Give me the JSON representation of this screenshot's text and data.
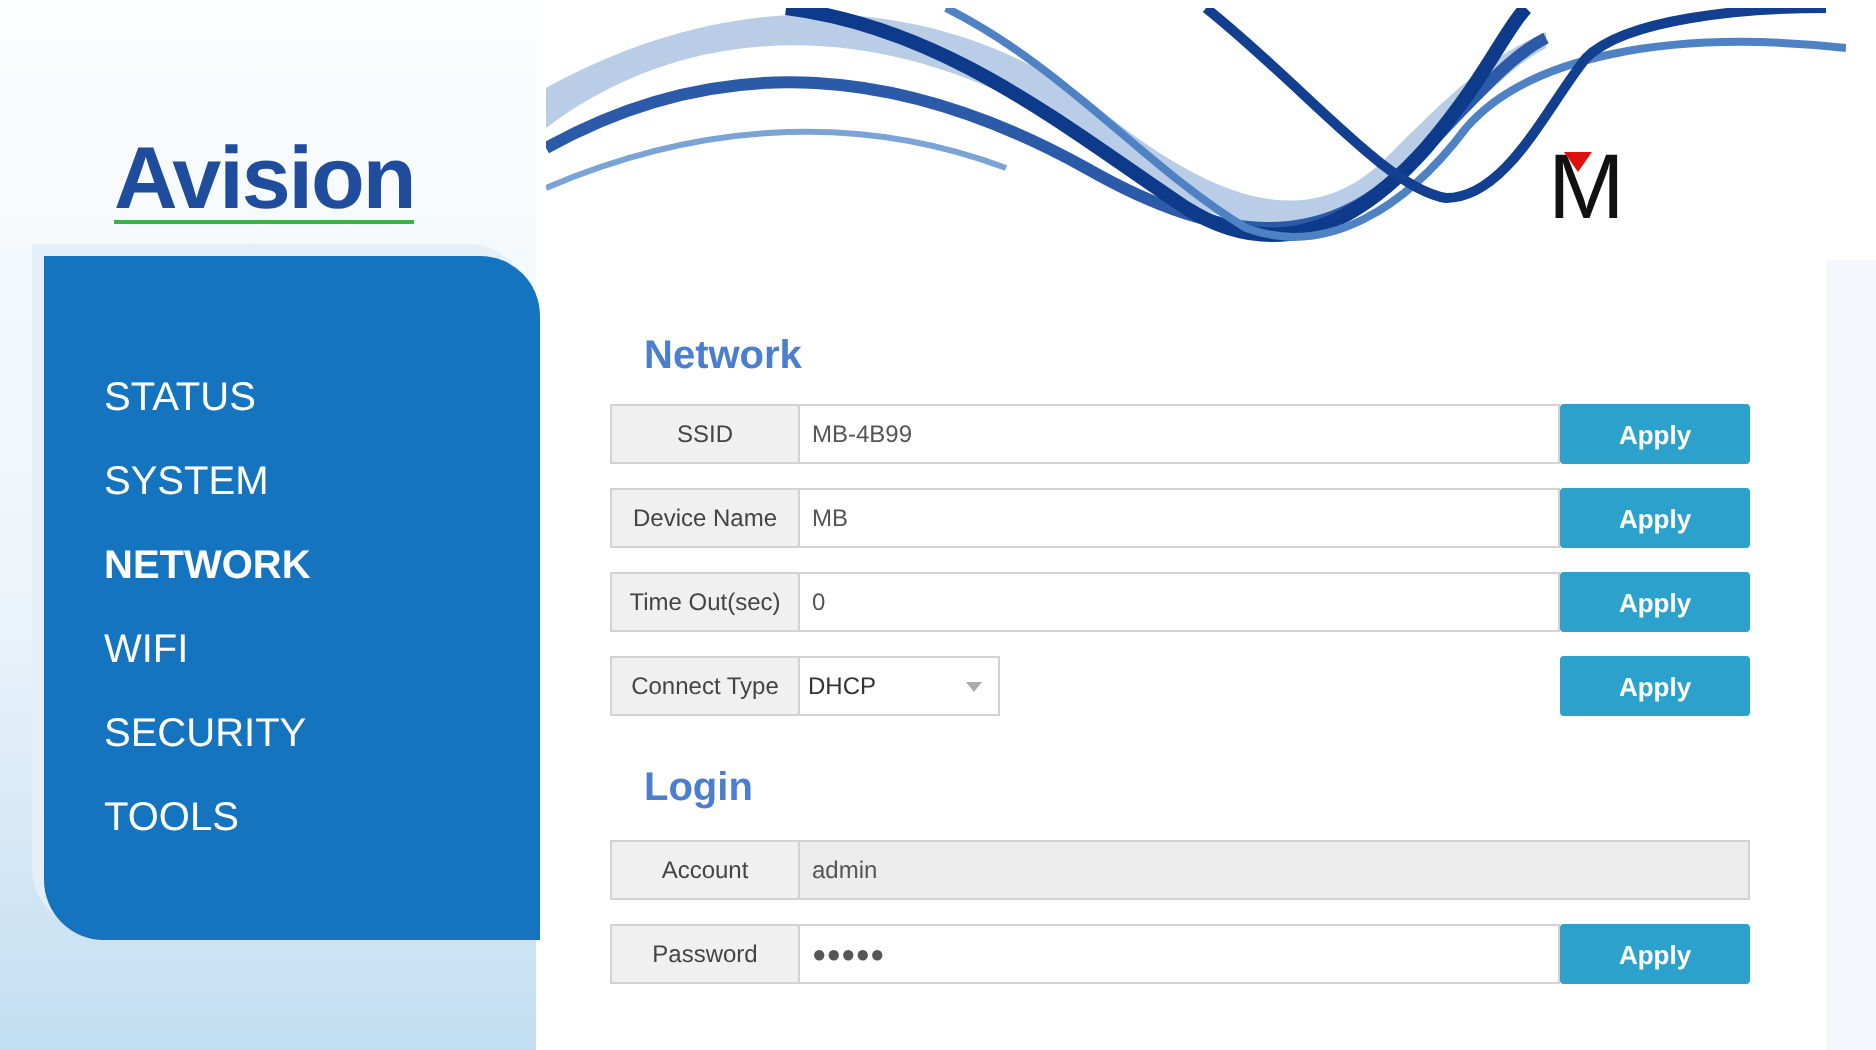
{
  "brand": {
    "logo": "Avision",
    "mark": "M"
  },
  "nav": [
    {
      "label": "STATUS",
      "selected": false
    },
    {
      "label": "SYSTEM",
      "selected": false
    },
    {
      "label": "NETWORK",
      "selected": true
    },
    {
      "label": "WIFI",
      "selected": false
    },
    {
      "label": "SECURITY",
      "selected": false
    },
    {
      "label": "TOOLS",
      "selected": false
    }
  ],
  "sections": [
    {
      "title": "Network",
      "rows": [
        {
          "kind": "text",
          "label": "SSID",
          "value": "MB-4B99",
          "disabled": false,
          "button": "Apply"
        },
        {
          "kind": "text",
          "label": "Device Name",
          "value": "MB",
          "disabled": false,
          "button": "Apply"
        },
        {
          "kind": "text",
          "label": "Time Out(sec)",
          "value": "0",
          "disabled": false,
          "button": "Apply"
        },
        {
          "kind": "select",
          "label": "Connect Type",
          "value": "DHCP",
          "disabled": false,
          "button": "Apply"
        }
      ]
    },
    {
      "title": "Login",
      "rows": [
        {
          "kind": "text",
          "label": "Account",
          "value": "admin",
          "disabled": true
        },
        {
          "kind": "text",
          "label": "Password",
          "value": "●●●●●",
          "disabled": false,
          "button": "Apply"
        }
      ]
    }
  ]
}
